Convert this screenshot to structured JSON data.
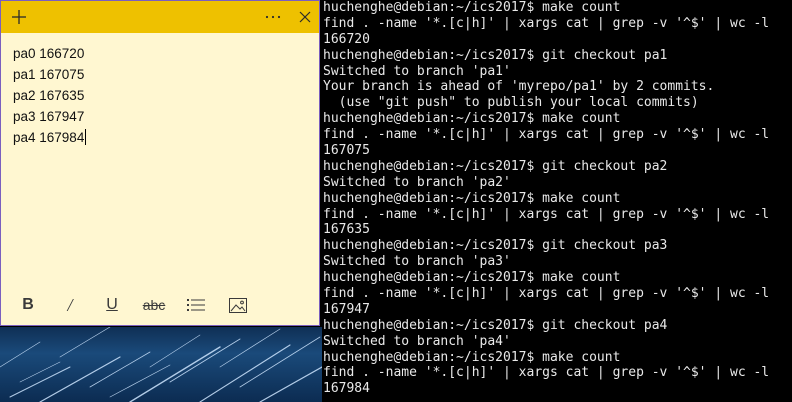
{
  "sticky_note": {
    "header": {
      "add_icon": "plus-icon",
      "menu_icon": "more-icon",
      "close_icon": "close-icon"
    },
    "lines": [
      "pa0 166720",
      "pa1 167075",
      "pa2 167635",
      "pa3 167947",
      "pa4 167984"
    ],
    "toolbar": {
      "bold": "B",
      "italic": "/",
      "underline": "U",
      "strikethrough": "abc",
      "list_icon": "bullet-list-icon",
      "image_icon": "image-icon"
    },
    "colors": {
      "header": "#eec100",
      "body": "#fff7d1"
    }
  },
  "terminal": {
    "lines": [
      "huchenghe@debian:~/ics2017$ make count",
      "find . -name '*.[c|h]' | xargs cat | grep -v '^$' | wc -l",
      "166720",
      "huchenghe@debian:~/ics2017$ git checkout pa1",
      "Switched to branch 'pa1'",
      "Your branch is ahead of 'myrepo/pa1' by 2 commits.",
      "  (use \"git push\" to publish your local commits)",
      "huchenghe@debian:~/ics2017$ make count",
      "find . -name '*.[c|h]' | xargs cat | grep -v '^$' | wc -l",
      "167075",
      "huchenghe@debian:~/ics2017$ git checkout pa2",
      "Switched to branch 'pa2'",
      "huchenghe@debian:~/ics2017$ make count",
      "find . -name '*.[c|h]' | xargs cat | grep -v '^$' | wc -l",
      "167635",
      "huchenghe@debian:~/ics2017$ git checkout pa3",
      "Switched to branch 'pa3'",
      "huchenghe@debian:~/ics2017$ make count",
      "find . -name '*.[c|h]' | xargs cat | grep -v '^$' | wc -l",
      "167947",
      "huchenghe@debian:~/ics2017$ git checkout pa4",
      "Switched to branch 'pa4'",
      "huchenghe@debian:~/ics2017$ make count",
      "find . -name '*.[c|h]' | xargs cat | grep -v '^$' | wc -l",
      "167984"
    ],
    "colors": {
      "background": "#000000",
      "text": "#e9e9e9"
    }
  }
}
